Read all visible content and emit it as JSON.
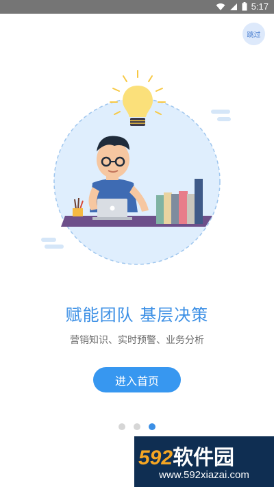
{
  "status_bar": {
    "time": "5:17",
    "icons": [
      "wifi-icon",
      "signal-icon",
      "battery-icon"
    ],
    "background": "#757575"
  },
  "skip_button": {
    "label": "跳过"
  },
  "illustration": {
    "subject": "person-at-desk-with-lightbulb",
    "accent": "#3b8fe5"
  },
  "headline": "赋能团队 基层决策",
  "subtitle": "营销知识、实时预警、业务分析",
  "enter_button": {
    "label": "进入首页",
    "color": "#3797f0"
  },
  "pagination": {
    "total": 3,
    "active_index": 2
  },
  "watermark": {
    "logo_number": "592",
    "logo_text": "软件园",
    "url": "www.592xiazai.com"
  }
}
